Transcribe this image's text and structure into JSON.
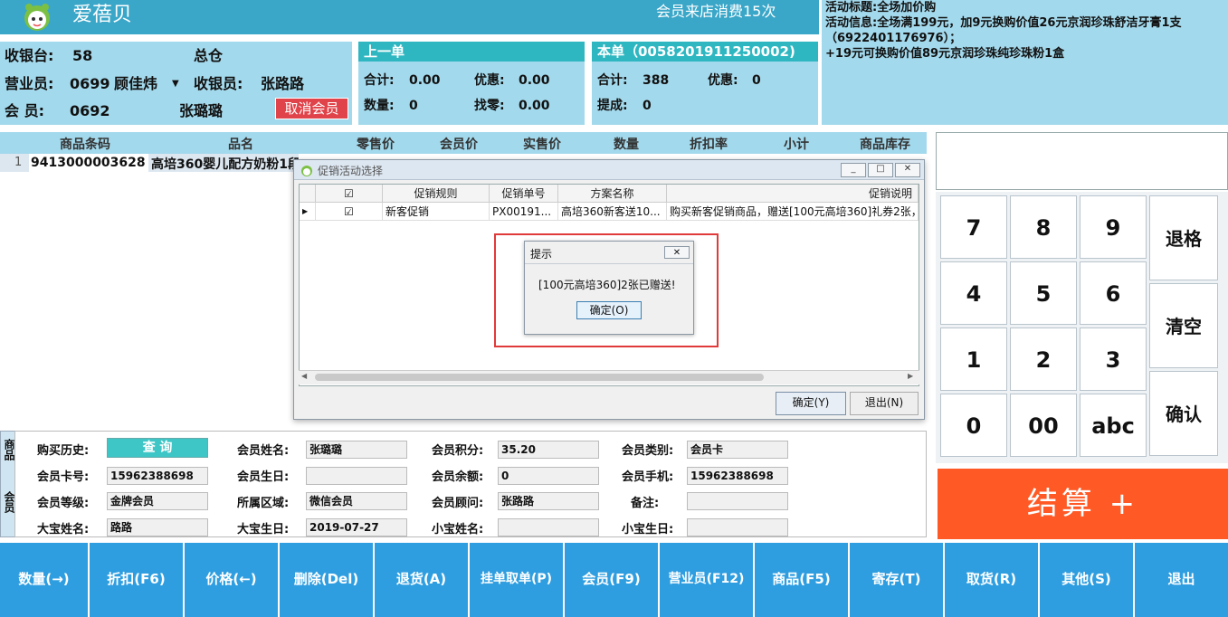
{
  "header": {
    "app_name": "爱蓓贝",
    "visit_info": "会员来店消费15次"
  },
  "activity": {
    "title": "活动标题:全场加价购",
    "info": "活动信息:全场满199元，加9元换购价值26元京润珍珠舒洁牙膏1支（6922401176976）；",
    "extra": "+19元可换购价值89元京润珍珠纯珍珠粉1盒"
  },
  "register": {
    "register_label": "收银台:",
    "register_no": "58",
    "warehouse": "总仓",
    "salesperson_label": "营业员:",
    "salesperson_code": "0699",
    "salesperson_name": "顾佳炜",
    "cashier_label": "收银员:",
    "cashier_name": "张路路",
    "member_label": "会 员:",
    "member_code": "0692",
    "member_name": "张璐璐",
    "cancel_member": "取消会员"
  },
  "prev_order": {
    "title": "上一单",
    "total_label": "合计:",
    "total": "0.00",
    "discount_label": "优惠:",
    "discount": "0.00",
    "qty_label": "数量:",
    "qty": "0",
    "change_label": "找零:",
    "change": "0.00"
  },
  "cur_order": {
    "title": "本单（0058201911250002)",
    "total_label": "合计:",
    "total": "388",
    "discount_label": "优惠:",
    "discount": "0",
    "commission_label": "提成:",
    "commission": "0"
  },
  "items_table": {
    "columns": [
      "商品条码",
      "品名",
      "零售价",
      "会员价",
      "实售价",
      "数量",
      "折扣率",
      "小计",
      "商品库存"
    ],
    "row_index": "1",
    "row_barcode": "9413000003628",
    "row_name": "高培360婴儿配方奶粉1段"
  },
  "keypad": {
    "keys": [
      "7",
      "8",
      "9",
      "4",
      "5",
      "6",
      "1",
      "2",
      "3",
      "0",
      "00",
      "abc"
    ],
    "backspace": "退格",
    "clear": "清空",
    "confirm": "确认",
    "checkout": "结算 +"
  },
  "member": {
    "side_tab_1": "商品",
    "side_tab_2": "会员",
    "history_label": "购买历史:",
    "query_btn": "查 询",
    "name_label": "会员姓名:",
    "name": "张璐璐",
    "points_label": "会员积分:",
    "points": "35.20",
    "type_label": "会员类别:",
    "type": "会员卡",
    "card_label": "会员卡号:",
    "card": "15962388698",
    "birthday_label": "会员生日:",
    "birthday": "",
    "balance_label": "会员余额:",
    "balance": "0",
    "phone_label": "会员手机:",
    "phone": "15962388698",
    "level_label": "会员等级:",
    "level": "金牌会员",
    "region_label": "所属区域:",
    "region": "微信会员",
    "advisor_label": "会员顾问:",
    "advisor": "张路路",
    "note_label": "备注:",
    "note": "",
    "child1_name_label": "大宝姓名:",
    "child1_name": "路路",
    "child1_bday_label": "大宝生日:",
    "child1_bday": "2019-07-27",
    "child2_name_label": "小宝姓名:",
    "child2_name": "",
    "child2_bday_label": "小宝生日:",
    "child2_bday": ""
  },
  "toolbar": {
    "buttons": [
      "数量(→)",
      "折扣(F6)",
      "价格(←)",
      "删除(Del)",
      "退货(A)",
      "挂单取单(P)",
      "会员(F9)",
      "营业员(F12)",
      "商品(F5)",
      "寄存(T)",
      "取货(R)",
      "其他(S)",
      "退出"
    ]
  },
  "promo_dialog": {
    "title": "促销活动选择",
    "columns": [
      "促销规则",
      "促销单号",
      "方案名称",
      "促销说明"
    ],
    "row": {
      "rule": "新客促销",
      "order_no": "PX00191...",
      "plan": "高培360新客送10...",
      "desc": "购买新客促销商品，赠送[100元高培360]礼券2张，"
    },
    "ok": "确定(Y)",
    "exit": "退出(N)"
  },
  "msgbox": {
    "title": "提示",
    "message": "[100元高培360]2张已赠送!",
    "ok": "确定(O)"
  },
  "colors": {
    "header": "#3aa6c8",
    "panel": "#a3d9ec",
    "checkout": "#ff5a25",
    "toolbar": "#2f9ee0",
    "highlight": "#e13a3a"
  }
}
